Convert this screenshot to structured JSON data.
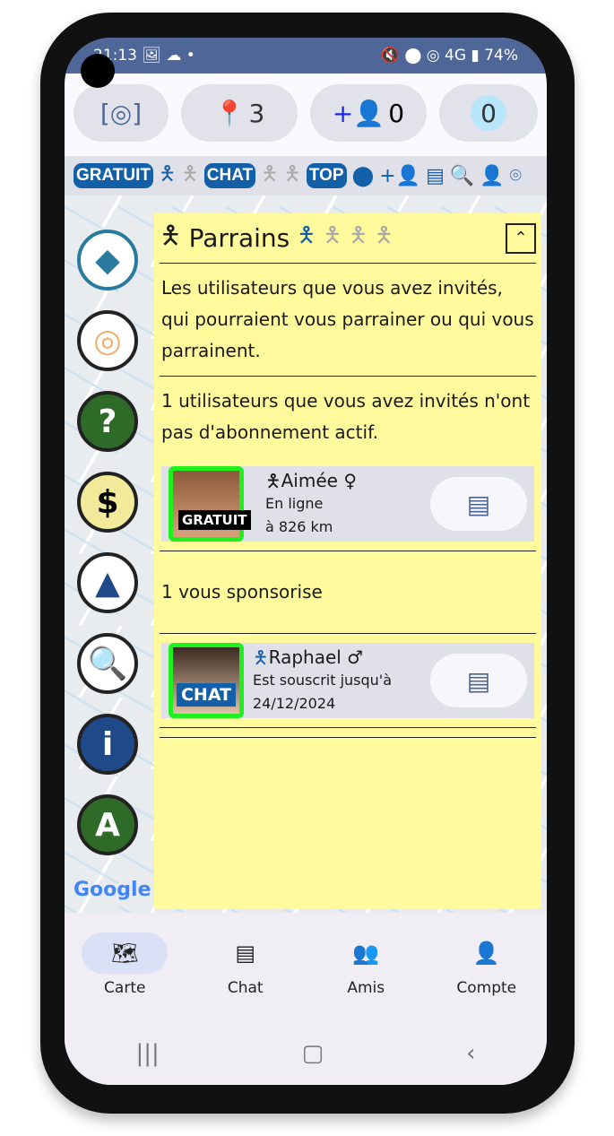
{
  "status": {
    "time": "21:13",
    "battery": "74%",
    "network": "4G"
  },
  "top": {
    "location_chat_count": "3",
    "add_friend_count": "0",
    "credit_count": "0"
  },
  "filters": {
    "gratuit": "GRATUIT",
    "chat": "CHAT",
    "top": "TOP"
  },
  "panel": {
    "title": "Parrains",
    "description": "Les utilisateurs que vous avez invités, qui pourraient vous parrainer ou qui vous parrainent.",
    "inactive_header": "1 utilisateurs que vous avez invités n'ont pas d'abonnement actif.",
    "sponsor_header": "1 vous sponsorise",
    "users": [
      {
        "name": "Aimée",
        "gender": "♀",
        "badge": "GRATUIT",
        "line1": "En ligne",
        "line2": "à 826 km"
      },
      {
        "name": "Raphael",
        "gender": "♂",
        "badge": "CHAT",
        "line1": "Est souscrit jusqu'à",
        "line2": "24/12/2024"
      }
    ]
  },
  "map": {
    "logo": "Google"
  },
  "nav": [
    {
      "label": "Carte",
      "icon": "map-icon"
    },
    {
      "label": "Chat",
      "icon": "chat-icon"
    },
    {
      "label": "Amis",
      "icon": "people-icon"
    },
    {
      "label": "Compte",
      "icon": "person-icon"
    }
  ],
  "colors": {
    "accent": "#1460a8",
    "panel": "#fffa9c",
    "status_bar": "#4e6698",
    "highlight": "#1ef01e"
  }
}
